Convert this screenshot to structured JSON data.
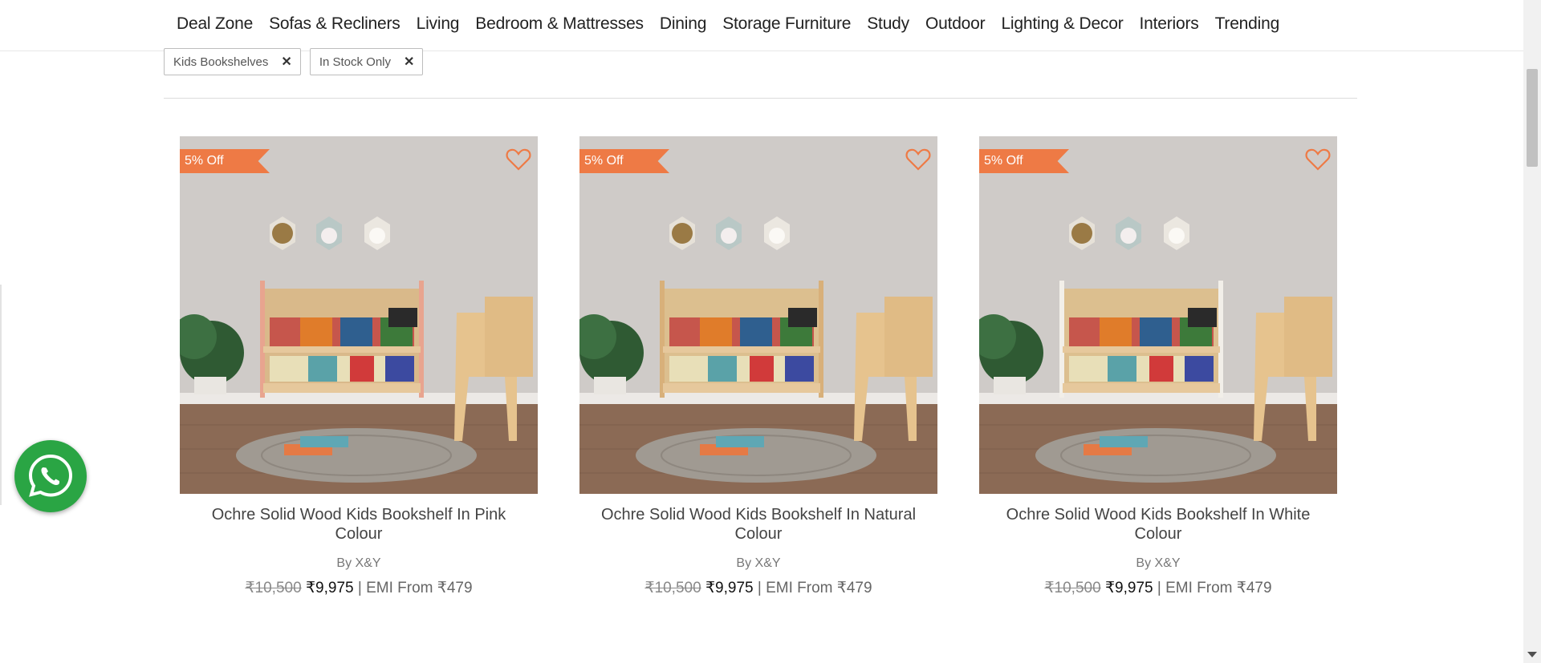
{
  "nav": {
    "items": [
      "Deal Zone",
      "Sofas & Recliners",
      "Living",
      "Bedroom & Mattresses",
      "Dining",
      "Storage Furniture",
      "Study",
      "Outdoor",
      "Lighting & Decor",
      "Interiors",
      "Trending"
    ]
  },
  "filters": {
    "chips": [
      {
        "label": "Kids Bookshelves",
        "remove_icon": "close-icon"
      },
      {
        "label": "In Stock Only",
        "remove_icon": "close-icon"
      }
    ]
  },
  "products": [
    {
      "badge": "5% Off",
      "title": "Ochre Solid Wood Kids Bookshelf In Pink Colour",
      "brand": "By X&Y",
      "old_price": "₹10,500",
      "price": "₹9,975",
      "emi": "| EMI From ₹479",
      "wishlist_icon": "heart-icon"
    },
    {
      "badge": "5% Off",
      "title": "Ochre Solid Wood Kids Bookshelf In Natural Colour",
      "brand": "By X&Y",
      "old_price": "₹10,500",
      "price": "₹9,975",
      "emi": "| EMI From ₹479",
      "wishlist_icon": "heart-icon"
    },
    {
      "badge": "5% Off",
      "title": "Ochre Solid Wood Kids Bookshelf In White Colour",
      "brand": "By X&Y",
      "old_price": "₹10,500",
      "price": "₹9,975",
      "emi": "| EMI From ₹479",
      "wishlist_icon": "heart-icon"
    }
  ],
  "whatsapp": {
    "icon": "whatsapp-icon"
  },
  "colors": {
    "accent": "#ee7a45",
    "whatsapp": "#2aa544"
  }
}
